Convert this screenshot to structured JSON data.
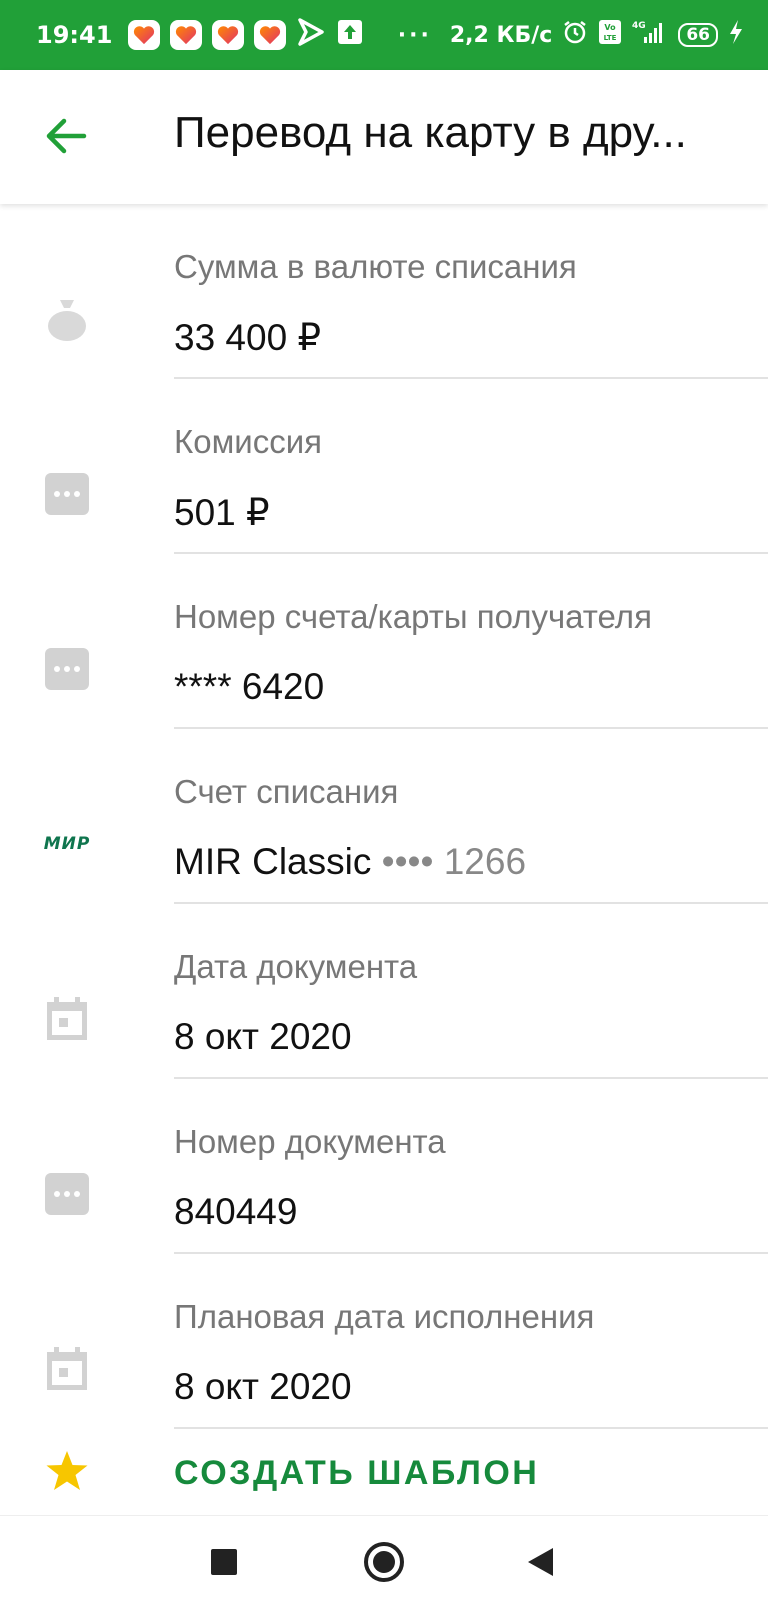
{
  "status_bar": {
    "time": "19:41",
    "speed": "2,2 КБ/с",
    "battery": "66",
    "dots": "···",
    "colors": {
      "background": "#21a038"
    },
    "icons": [
      "heart-app-icon",
      "heart-app-icon",
      "heart-app-icon",
      "heart-app-icon",
      "play-arrow-icon",
      "upload-icon",
      "alarm-icon",
      "volte-icon",
      "signal-4g-icon",
      "battery-icon",
      "charging-icon"
    ]
  },
  "app_bar": {
    "title": "Перевод на карту в дру...",
    "back_icon": "arrow-back-icon",
    "colors": {
      "accent": "#21a038"
    }
  },
  "details": [
    {
      "label": "Сумма в валюте списания",
      "value": "33 400 ₽",
      "icon": "money-bag-icon"
    },
    {
      "label": "Комиссия",
      "value": "501 ₽",
      "icon": "dots-icon"
    },
    {
      "label": "Номер счета/карты получателя",
      "value": "**** 6420",
      "icon": "dots-icon"
    },
    {
      "label": "Счет списания",
      "value": "MIR Classic",
      "value_extra": " •••• 1266",
      "icon": "mir-logo-icon",
      "icon_text": "МИР"
    },
    {
      "label": "Дата документа",
      "value": "8 окт 2020",
      "icon": "calendar-icon"
    },
    {
      "label": "Номер документа",
      "value": "840449",
      "icon": "dots-icon"
    },
    {
      "label": "Плановая дата исполнения",
      "value": "8 окт 2020",
      "icon": "calendar-icon"
    }
  ],
  "template": {
    "label": "СОЗДАТЬ ШАБЛОН",
    "icon": "star-icon",
    "colors": {
      "text": "#168a3c",
      "star": "#f7c600"
    }
  },
  "nav_bar": {
    "icons": [
      "recents-square-icon",
      "home-circle-icon",
      "back-triangle-icon"
    ]
  }
}
